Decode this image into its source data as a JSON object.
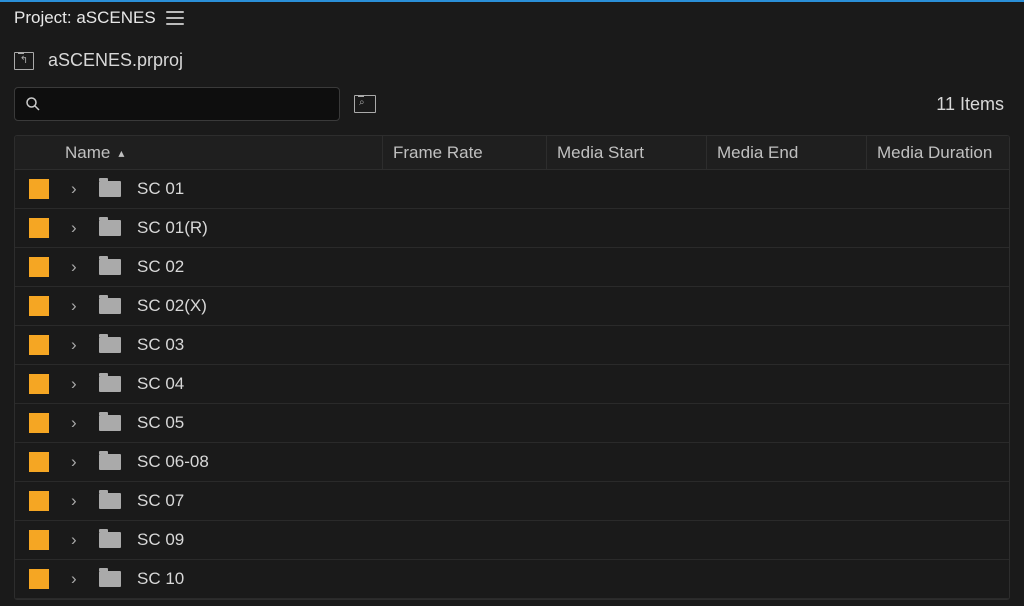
{
  "header": {
    "panel_title": "Project: aSCENES",
    "project_file": "aSCENES.prproj"
  },
  "toolbar": {
    "search_placeholder": "",
    "item_count_text": "11 Items"
  },
  "columns": {
    "name": "Name",
    "frame_rate": "Frame Rate",
    "media_start": "Media Start",
    "media_end": "Media End",
    "media_duration": "Media Duration"
  },
  "rows": [
    {
      "name": "SC 01"
    },
    {
      "name": "SC 01(R)"
    },
    {
      "name": "SC 02"
    },
    {
      "name": "SC 02(X)"
    },
    {
      "name": "SC 03"
    },
    {
      "name": "SC 04"
    },
    {
      "name": "SC 05"
    },
    {
      "name": "SC 06-08"
    },
    {
      "name": "SC 07"
    },
    {
      "name": "SC 09"
    },
    {
      "name": "SC 10"
    }
  ],
  "colors": {
    "chip": "#f5a623"
  }
}
